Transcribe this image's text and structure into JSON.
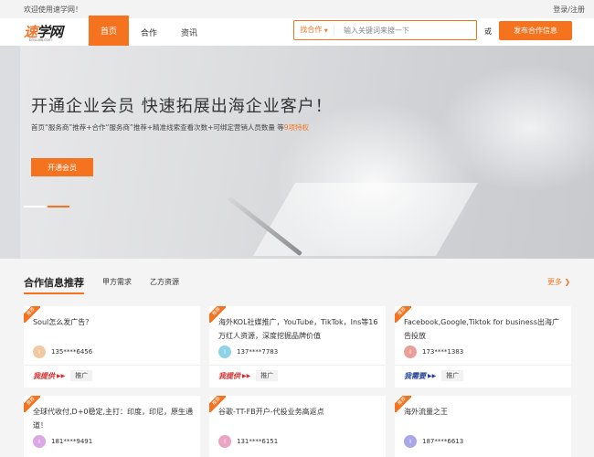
{
  "topbar": {
    "welcome": "欢迎使用速学网！",
    "login": "登录/注册"
  },
  "logo": {
    "cn_a": "速",
    "cn_b": "学网",
    "en": "bnsuxw.com"
  },
  "nav": {
    "items": [
      "首页",
      "合作",
      "资讯"
    ],
    "active_index": 0
  },
  "search": {
    "category": "找合作",
    "placeholder": "输入关键词来搜一下",
    "value": ""
  },
  "header": {
    "or": "或",
    "publish": "发布合作信息"
  },
  "banner": {
    "title": "开通企业会员  快速拓展出海企业客户！",
    "subtitle_main": "首页“服务商”推荐+合作“服务商”推荐+精准线索查看次数+可绑定营销人员数量 等",
    "subtitle_highlight": "9项特权",
    "button": "开通会员"
  },
  "section": {
    "title": "合作信息推荐",
    "tabs": [
      "甲方需求",
      "乙方资源"
    ],
    "more": "更多"
  },
  "cards": [
    {
      "ribbon": "推荐",
      "title": "Soul怎么发广告？",
      "avatar": "I",
      "avatar_color": "#f0c9a0",
      "phone": "135****6456",
      "kind": "我提供",
      "kind_type": "provide",
      "tag": "推广"
    },
    {
      "ribbon": "推荐",
      "title": "海外KOL社媒推广，YouTube，TikTok，Ins等16万红人资源，深度挖掘品牌价值",
      "avatar": "I",
      "avatar_color": "#8fd3e8",
      "phone": "137****7783",
      "kind": "我提供",
      "kind_type": "provide",
      "tag": "推广"
    },
    {
      "ribbon": "推荐",
      "title": "Facebook,Google,Tiktok for business出海广告投放",
      "avatar": "I",
      "avatar_color": "#e9a09a",
      "phone": "173****1383",
      "kind": "我需要",
      "kind_type": "need",
      "tag": "推广"
    },
    {
      "ribbon": "推荐",
      "title": "全球代收付,D+0稳定,主打：印度，印尼，原生通道！",
      "avatar": "I",
      "avatar_color": "#dba8e6",
      "phone": "181****9491",
      "kind": "",
      "kind_type": "provide",
      "tag": ""
    },
    {
      "ribbon": "推荐",
      "title": "谷歌-TT-FB开户-代投业务高返点",
      "avatar": "I",
      "avatar_color": "#e9a5c3",
      "phone": "131****6151",
      "kind": "",
      "kind_type": "provide",
      "tag": ""
    },
    {
      "ribbon": "推荐",
      "title": "海外流量之王",
      "avatar": "I",
      "avatar_color": "#a9a8e6",
      "phone": "187****6613",
      "kind": "",
      "kind_type": "need",
      "tag": ""
    }
  ],
  "colors": {
    "accent": "#f5731f",
    "provide": "#d92a2a",
    "need": "#1f3f9a"
  }
}
